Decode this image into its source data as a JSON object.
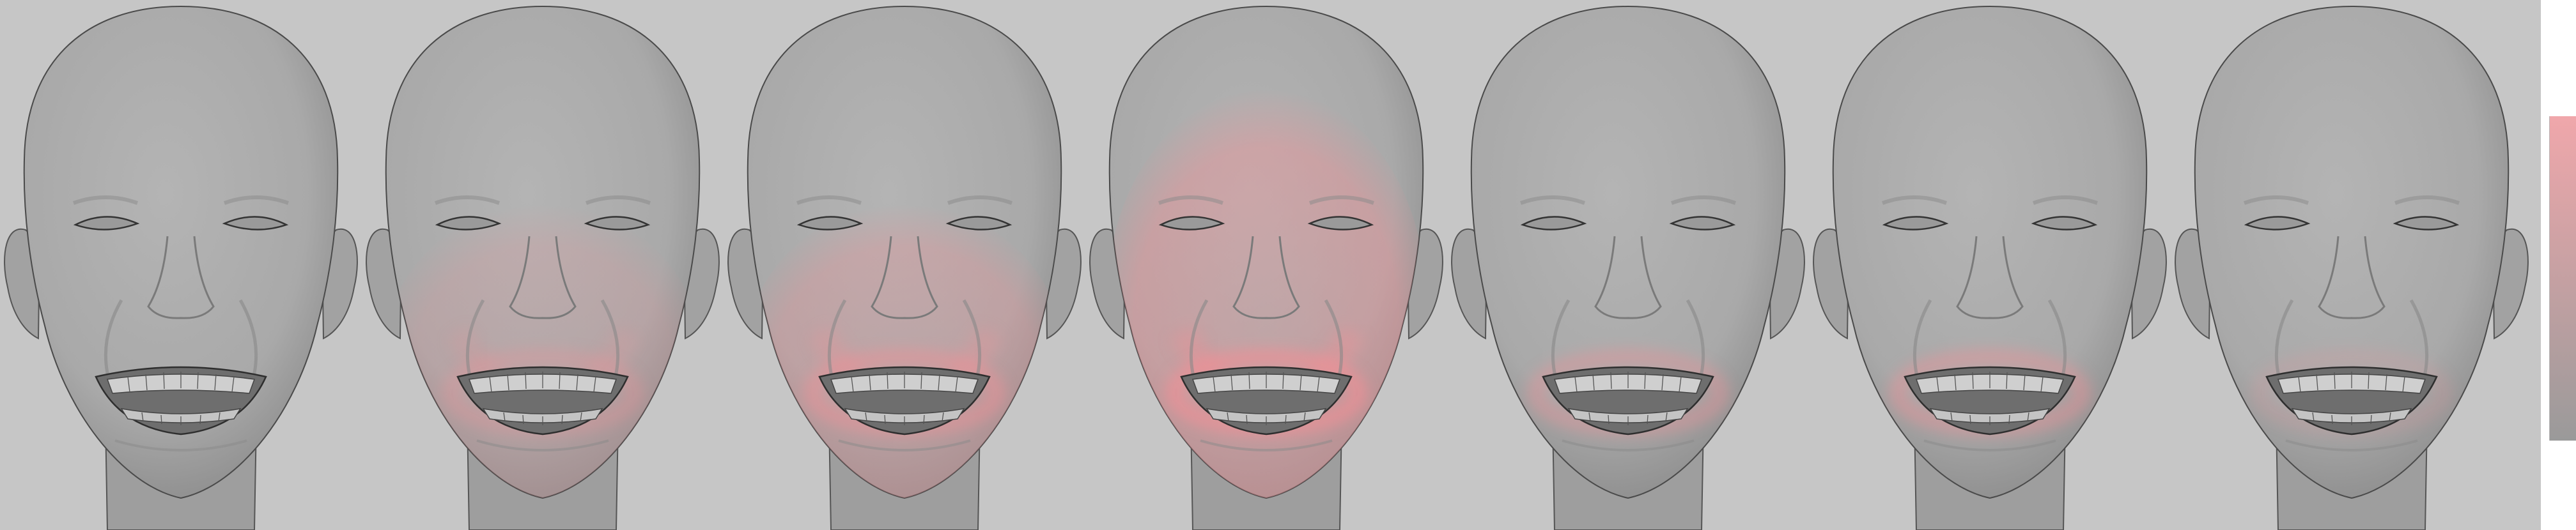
{
  "colors": {
    "background": "#c6c6c6",
    "skin": "#a9a9a9",
    "highlight": "#f08f95",
    "colorbar_top": "#f0a7ab",
    "colorbar_bottom": "#9a9a9a"
  },
  "faces": [
    {
      "index": 1,
      "highlight_intensity": 0.0,
      "highlight_region": "none"
    },
    {
      "index": 2,
      "highlight_intensity": 0.35,
      "highlight_region": "lower-face"
    },
    {
      "index": 3,
      "highlight_intensity": 0.55,
      "highlight_region": "lower-face"
    },
    {
      "index": 4,
      "highlight_intensity": 0.75,
      "highlight_region": "full-face"
    },
    {
      "index": 5,
      "highlight_intensity": 0.45,
      "highlight_region": "mouth"
    },
    {
      "index": 6,
      "highlight_intensity": 0.5,
      "highlight_region": "mouth"
    },
    {
      "index": 7,
      "highlight_intensity": 0.2,
      "highlight_region": "mouth"
    }
  ],
  "colorbar": {
    "gradient": "top-pink-to-bottom-gray"
  }
}
